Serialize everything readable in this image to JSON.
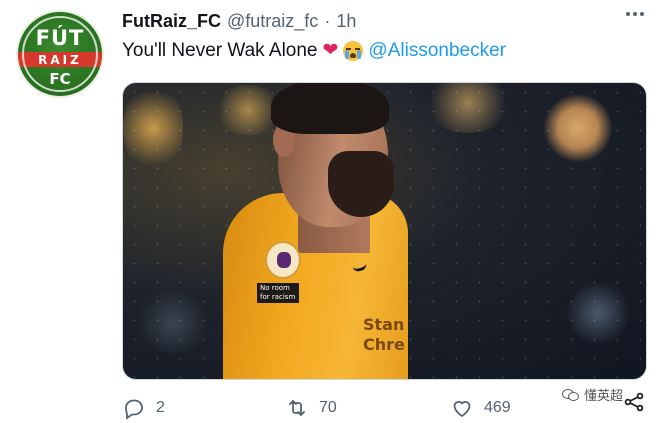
{
  "tweet": {
    "author": {
      "display_name": "FutRaiz_FC",
      "handle": "@futraiz_fc",
      "separator": "·",
      "time": "1h",
      "avatar": {
        "line1": "FÚT",
        "line2": "RAIZ",
        "line3": "FC",
        "colors": {
          "green": "#2b7422",
          "red": "#d6382b"
        }
      }
    },
    "text": "You'll Never Wak Alone",
    "emojis": [
      "red-heart-emoji",
      "crying-face-emoji"
    ],
    "heart_glyph": "❤",
    "mention": "@Alissonbecker",
    "media": {
      "badge_text": "No room for racism",
      "sponsor_line1": "Stan",
      "sponsor_line2": "Chre"
    },
    "actions": {
      "reply_count": "2",
      "retweet_count": "70",
      "like_count": "469"
    }
  },
  "watermark": {
    "text": "懂英超"
  },
  "colors": {
    "accent": "#1d9bf0",
    "text_secondary": "#536471",
    "jersey": "#f3a91f"
  }
}
